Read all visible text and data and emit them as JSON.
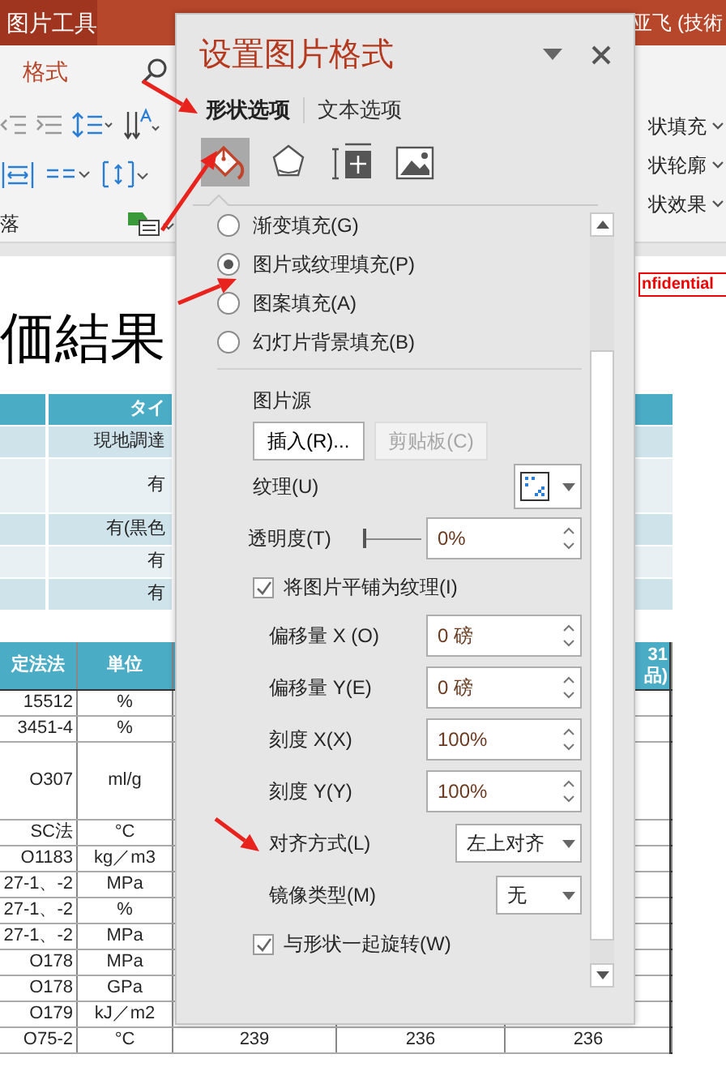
{
  "title_bar": {
    "tool_tab": "图片工具",
    "user": "亚飞 (技術"
  },
  "ribbon": {
    "tabs": [
      {
        "label": "格式",
        "selected": true
      }
    ],
    "shape_commands": [
      "状填充",
      "状轮廓",
      "状效果"
    ],
    "group_label": "落"
  },
  "slide": {
    "title": "価結果",
    "confidential": "nfidential",
    "top_table": {
      "header": "タイ",
      "rows": [
        {
          "text": "現地調達"
        },
        {
          "text": "有"
        },
        {
          "text": "有(黒色"
        },
        {
          "text": "有"
        },
        {
          "text": "有"
        }
      ]
    },
    "bottom_table": {
      "header": {
        "column_1": "定法法",
        "column_2": "単位",
        "column_5": [
          "31",
          "品)"
        ]
      },
      "rows": [
        {
          "column_1": "15512",
          "column_2": "%"
        },
        {
          "column_1": "3451-4",
          "column_2": "%"
        },
        {
          "column_1": "O307",
          "column_2": "ml/g",
          "tall": true
        },
        {
          "column_1": "SC法",
          "column_2": "°C"
        },
        {
          "column_1": "O1183",
          "column_2": "kg／m3"
        },
        {
          "column_1": "27-1、-2",
          "column_2": "MPa"
        },
        {
          "column_1": "27-1、-2",
          "column_2": "%"
        },
        {
          "column_1": "27-1、-2",
          "column_2": "MPa"
        },
        {
          "column_1": "O178",
          "column_2": "MPa"
        },
        {
          "column_1": "O178",
          "column_2": "GPa"
        },
        {
          "column_1": "O179",
          "column_2": "kJ／m2"
        },
        {
          "column_1": "O75-2",
          "column_2": "°C",
          "column_3": "239",
          "column_4": "236",
          "column_5": "236"
        }
      ]
    }
  },
  "format_pane": {
    "title": "设置图片格式",
    "tabs": [
      {
        "label": "形状选项",
        "selected": true
      },
      {
        "label": "文本选项",
        "selected": false
      }
    ],
    "icon_tabs": [
      {
        "kind": "fill",
        "selected": true
      },
      {
        "kind": "shape",
        "selected": false
      },
      {
        "kind": "size",
        "selected": false
      },
      {
        "kind": "picture",
        "selected": false
      }
    ],
    "fill_options": [
      {
        "label": "渐变填充(G)",
        "selected": false
      },
      {
        "label": "图片或纹理填充(P)",
        "selected": true
      },
      {
        "label": "图案填充(A)",
        "selected": false
      },
      {
        "label": "幻灯片背景填充(B)",
        "selected": false
      }
    ],
    "picture_source": {
      "heading": "图片源",
      "buttons": [
        {
          "label": "插入(R)...",
          "disabled": false
        },
        {
          "label": "剪贴板(C)",
          "disabled": true
        }
      ]
    },
    "settings": [
      {
        "kind": "texture",
        "label": "纹理(U)"
      },
      {
        "kind": "slider",
        "label": "透明度(T)",
        "level": 0,
        "value": "0%"
      },
      {
        "kind": "checkbox",
        "label": "将图片平铺为纹理(I)",
        "checked": true
      },
      {
        "kind": "spinner",
        "label": "偏移量 X (O)",
        "value": "0 磅"
      },
      {
        "kind": "spinner",
        "label": "偏移量 Y(E)",
        "value": "0 磅"
      },
      {
        "kind": "spinner",
        "label": "刻度 X(X)",
        "value": "100%"
      },
      {
        "kind": "spinner",
        "label": "刻度 Y(Y)",
        "value": "100%"
      },
      {
        "kind": "dropdown",
        "label": "对齐方式(L)",
        "value": "左上对齐",
        "wide": true
      },
      {
        "kind": "dropdown",
        "label": "镜像类型(M)",
        "value": "无",
        "wide": false
      },
      {
        "kind": "checkbox",
        "label": "与形状一起旋转(W)",
        "checked": true
      }
    ]
  }
}
